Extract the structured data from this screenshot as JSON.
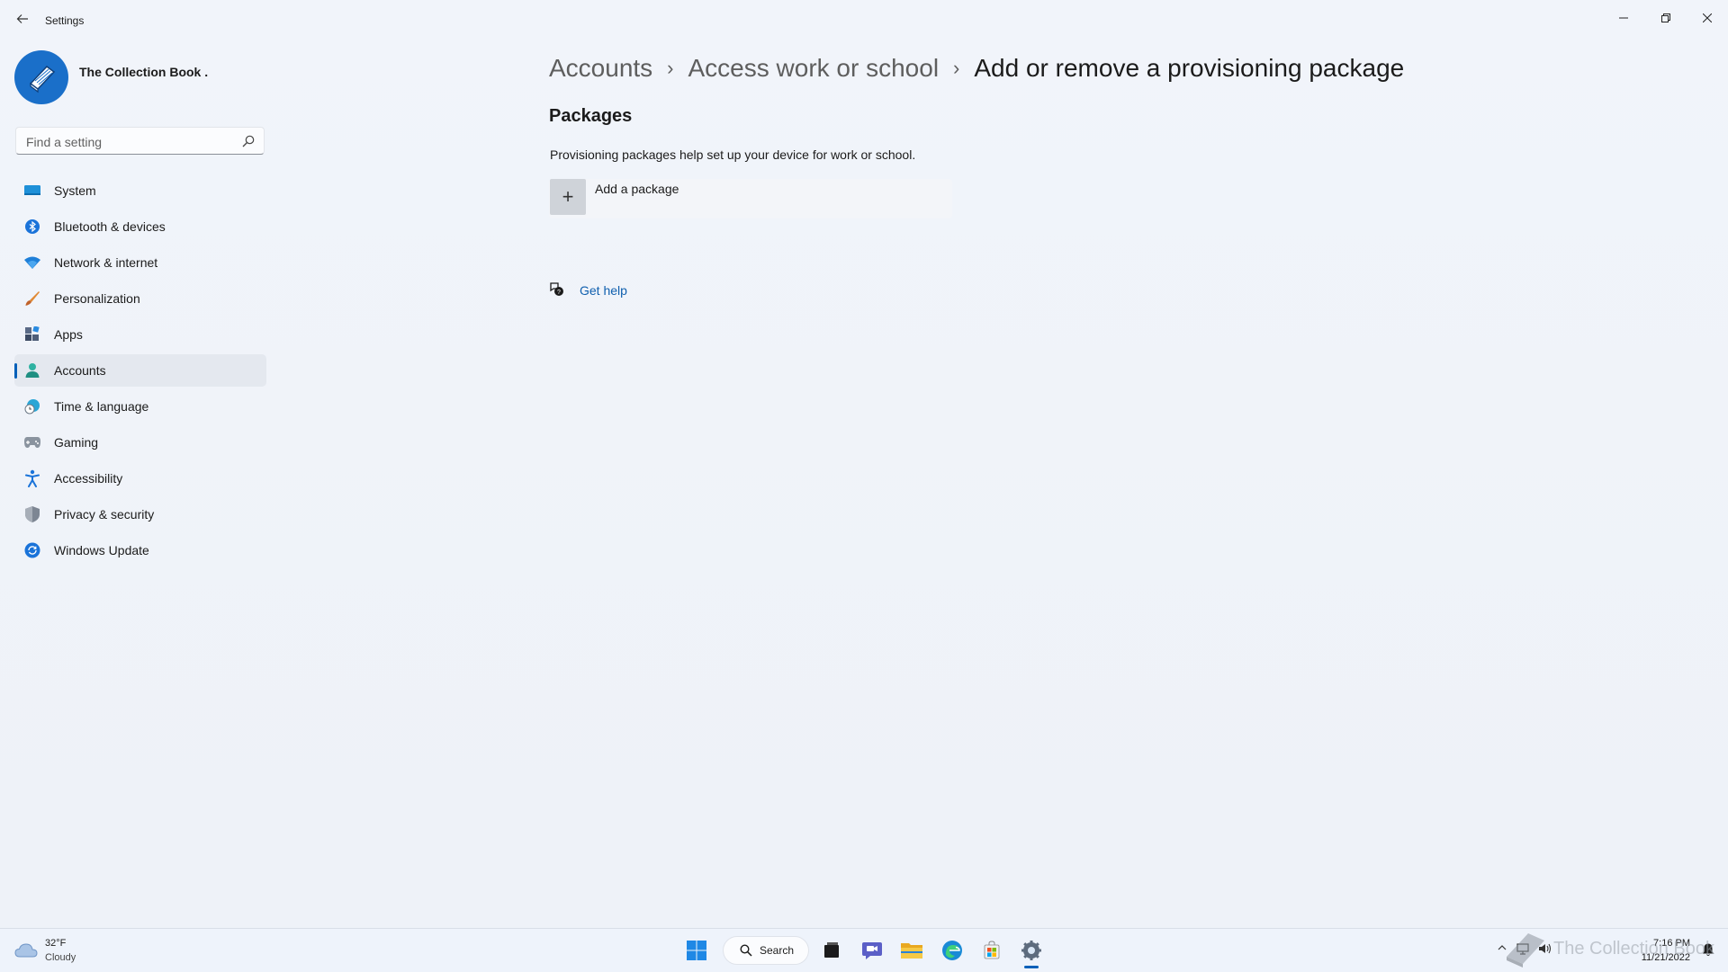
{
  "window": {
    "title": "Settings",
    "controls": [
      "minimize",
      "restore",
      "close"
    ]
  },
  "profile": {
    "name": "The Collection Book ."
  },
  "search": {
    "placeholder": "Find a setting",
    "value": ""
  },
  "sidebar": {
    "active": "Accounts",
    "items": [
      {
        "label": "System",
        "icon": "monitor-icon"
      },
      {
        "label": "Bluetooth & devices",
        "icon": "bluetooth-icon"
      },
      {
        "label": "Network & internet",
        "icon": "wifi-icon"
      },
      {
        "label": "Personalization",
        "icon": "brush-icon"
      },
      {
        "label": "Apps",
        "icon": "apps-icon"
      },
      {
        "label": "Accounts",
        "icon": "person-icon"
      },
      {
        "label": "Time & language",
        "icon": "clock-globe-icon"
      },
      {
        "label": "Gaming",
        "icon": "gamepad-icon"
      },
      {
        "label": "Accessibility",
        "icon": "accessibility-icon"
      },
      {
        "label": "Privacy & security",
        "icon": "shield-icon"
      },
      {
        "label": "Windows Update",
        "icon": "update-icon"
      }
    ]
  },
  "breadcrumb": {
    "items": [
      "Accounts",
      "Access work or school",
      "Add or remove a provisioning package"
    ],
    "separator": "›"
  },
  "main": {
    "section_title": "Packages",
    "description": "Provisioning packages help set up your device for work or school.",
    "add_package_label": "Add a package",
    "add_button_symbol": "+",
    "get_help_label": "Get help"
  },
  "taskbar": {
    "weather": {
      "temp": "32°F",
      "condition": "Cloudy"
    },
    "search_label": "Search",
    "pinned": [
      "start-icon",
      "search-icon",
      "task-view-icon",
      "chat-icon",
      "file-explorer-icon",
      "edge-icon",
      "store-icon",
      "settings-icon"
    ],
    "clock": {
      "time": "7:16 PM",
      "date": "11/21/2022"
    }
  },
  "watermark": {
    "text": "The Collection Book"
  },
  "colors": {
    "accent": "#005fb8",
    "link": "#0f5fae",
    "background": "#eef2f9"
  }
}
